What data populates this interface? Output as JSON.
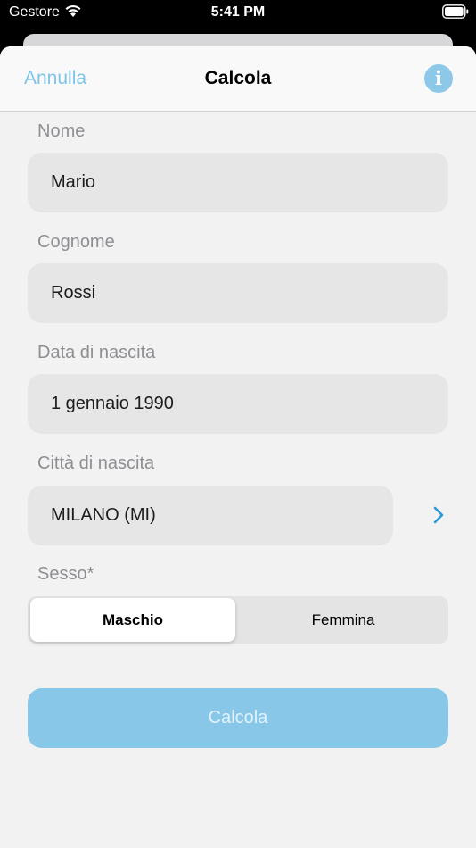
{
  "status_bar": {
    "carrier": "Gestore",
    "time": "5:41 PM"
  },
  "navbar": {
    "cancel_label": "Annulla",
    "title": "Calcola",
    "info_glyph": "i"
  },
  "form": {
    "nome": {
      "label": "Nome",
      "value": "Mario"
    },
    "cognome": {
      "label": "Cognome",
      "value": "Rossi"
    },
    "data_nascita": {
      "label": "Data di nascita",
      "value": "1 gennaio 1990"
    },
    "citta_nascita": {
      "label": "Città di nascita",
      "value": "MILANO (MI)"
    },
    "sesso": {
      "label": "Sesso*",
      "options": [
        "Maschio",
        "Femmina"
      ],
      "selected": "Maschio"
    }
  },
  "submit_label": "Calcola",
  "colors": {
    "accent": "#7ec4e6",
    "button_bg": "#88c7e8",
    "field_bg": "#e6e6e6"
  },
  "icons": {
    "wifi": "wifi-icon",
    "battery": "battery-icon",
    "info": "info-icon",
    "chevron": "chevron-right-icon"
  }
}
